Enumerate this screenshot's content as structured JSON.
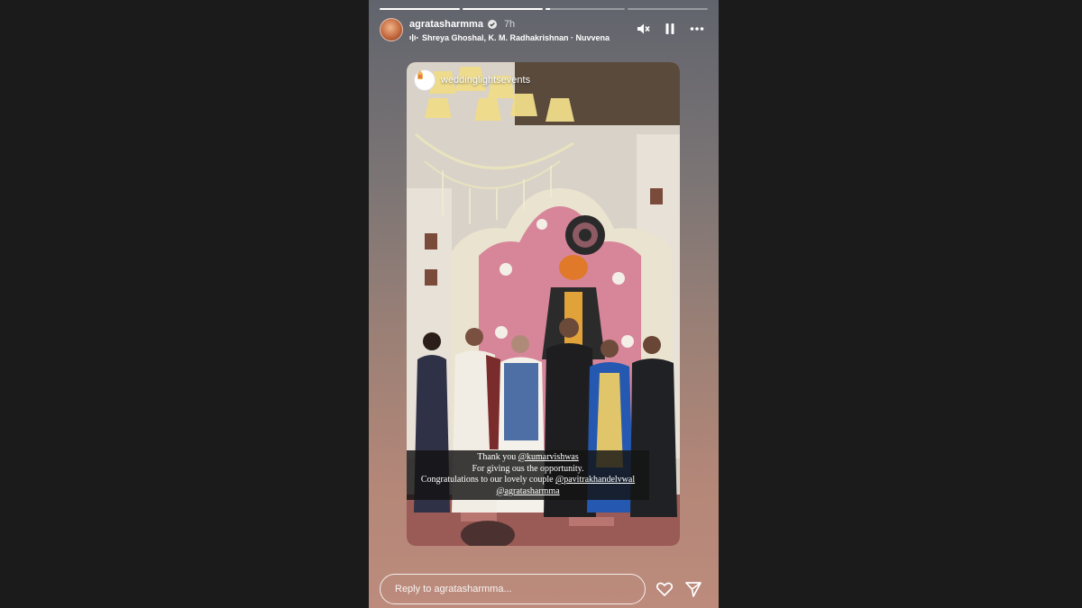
{
  "story": {
    "progress": [
      1.0,
      1.0,
      0.06,
      0.0
    ],
    "username": "agratasharmma",
    "time": "7h",
    "music": "Shreya Ghoshal, K. M. Radhakrishnan · Nuvvena"
  },
  "post": {
    "source_account": "weddinglightsevents",
    "caption": {
      "line1_prefix": "Thank you ",
      "line1_mention": "@kumarvishwas",
      "line2": "For giving ous the opportunity.",
      "line3_prefix": "Congratulations to our lovely couple ",
      "line3_mention": "@pavitrakhandelvwal",
      "line4_mention": "@agratasharmma"
    }
  },
  "reply": {
    "placeholder": "Reply to agratasharmma..."
  },
  "icons": {
    "verified": "verified-badge-icon",
    "music": "music-bars-icon",
    "mute": "speaker-muted-icon",
    "pause": "pause-icon",
    "more": "more-dots-icon",
    "like": "heart-icon",
    "send": "send-icon"
  }
}
